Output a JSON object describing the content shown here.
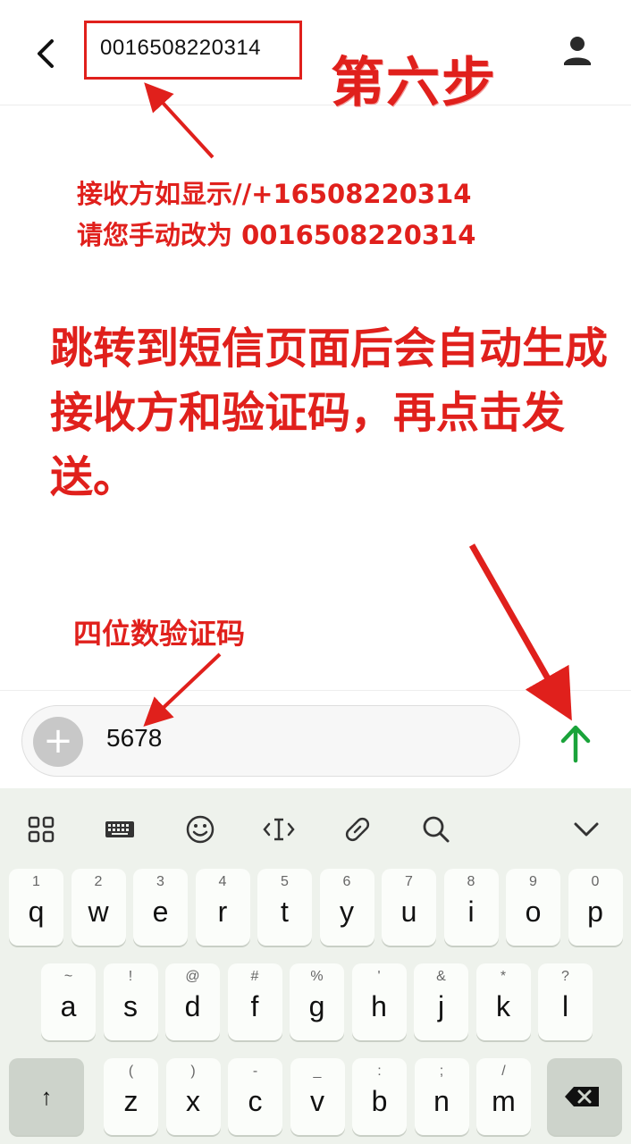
{
  "header": {
    "recipient": "0016508220314",
    "back_icon": "chevron-left-icon",
    "contact_icon": "person-icon"
  },
  "annotations": {
    "step_title": "第六步",
    "recipient_note_line1": "接收方如显示//+16508220314",
    "recipient_note_line2": "请您手动改为 0016508220314",
    "main_note": "跳转到短信页面后会自动生成接收方和验证码，再点击发送。",
    "code_note": "四位数验证码",
    "color": "#e0201c"
  },
  "compose": {
    "plus_label": "+",
    "message_text": "5678",
    "send_icon": "arrow-up-icon",
    "send_color": "#1aa33a"
  },
  "keyboard": {
    "toolbar_icons": [
      "grid-icon",
      "keyboard-icon",
      "emoji-icon",
      "cursor-icon",
      "clipboard-icon",
      "search-icon",
      "chevron-down-icon"
    ],
    "rows": [
      [
        {
          "main": "q",
          "hint": "1"
        },
        {
          "main": "w",
          "hint": "2"
        },
        {
          "main": "e",
          "hint": "3"
        },
        {
          "main": "r",
          "hint": "4"
        },
        {
          "main": "t",
          "hint": "5"
        },
        {
          "main": "y",
          "hint": "6"
        },
        {
          "main": "u",
          "hint": "7"
        },
        {
          "main": "i",
          "hint": "8"
        },
        {
          "main": "o",
          "hint": "9"
        },
        {
          "main": "p",
          "hint": "0"
        }
      ],
      [
        {
          "main": "a",
          "hint": "~"
        },
        {
          "main": "s",
          "hint": "!"
        },
        {
          "main": "d",
          "hint": "@"
        },
        {
          "main": "f",
          "hint": "#"
        },
        {
          "main": "g",
          "hint": "%"
        },
        {
          "main": "h",
          "hint": "'"
        },
        {
          "main": "j",
          "hint": "&"
        },
        {
          "main": "k",
          "hint": "*"
        },
        {
          "main": "l",
          "hint": "?"
        }
      ],
      [
        {
          "main": "z",
          "hint": "("
        },
        {
          "main": "x",
          "hint": ")"
        },
        {
          "main": "c",
          "hint": "-"
        },
        {
          "main": "v",
          "hint": "_"
        },
        {
          "main": "b",
          "hint": ":"
        },
        {
          "main": "n",
          "hint": ";"
        },
        {
          "main": "m",
          "hint": "/"
        }
      ]
    ],
    "shift_label": "↑",
    "shift_icon": "shift-icon",
    "backspace_icon": "backspace-icon"
  }
}
